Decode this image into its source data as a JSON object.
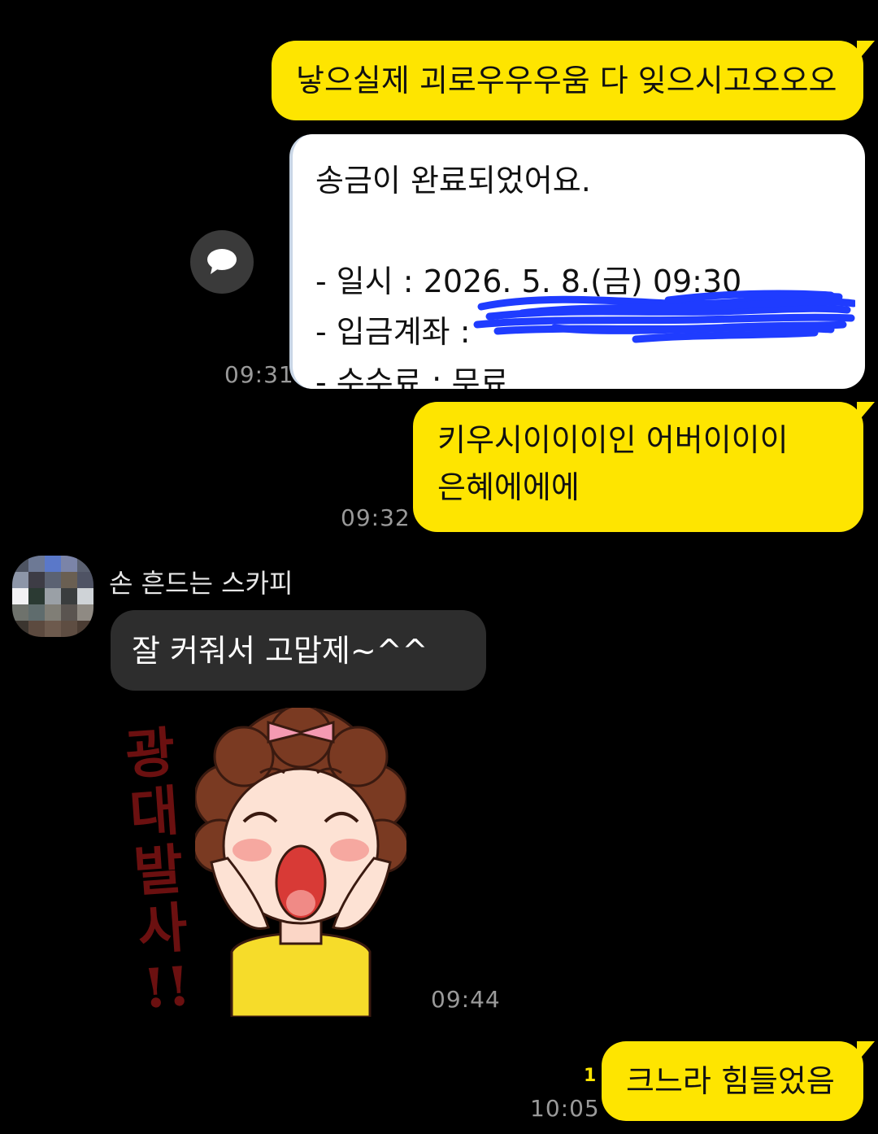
{
  "messages": {
    "m1": {
      "text": "낳으실제 괴로우우우움 다 잊으시고오오오"
    },
    "transfer": {
      "title": "송금이 완료되었어요.",
      "date_label": "- 일시 : ",
      "date_value": "2026. 5. 8.(금) 09:30",
      "account_label": "- 입금계좌 :",
      "fee_label": "- 수수료 : ",
      "fee_value": "무료",
      "time": "09:31"
    },
    "m3": {
      "line1": "키우시이이이인 어버이이이",
      "line2": "은혜에에에",
      "time": "09:32"
    },
    "incoming": {
      "sender": "손 흔드는 스카피",
      "text": "잘 커줘서 고맙제~^^",
      "sticker_caption": [
        "광",
        "대",
        "발",
        "사",
        "!!"
      ],
      "sticker_time": "09:44"
    },
    "m5": {
      "text": "크느라 힘들었음",
      "unread": "1",
      "time": "10:05"
    }
  },
  "colors": {
    "my_bubble": "#FEE500",
    "other_bubble": "#2d2d2d",
    "background": "#000000",
    "scribble": "#1f3cff"
  },
  "icons": {
    "share": "speech-bubble-icon"
  }
}
